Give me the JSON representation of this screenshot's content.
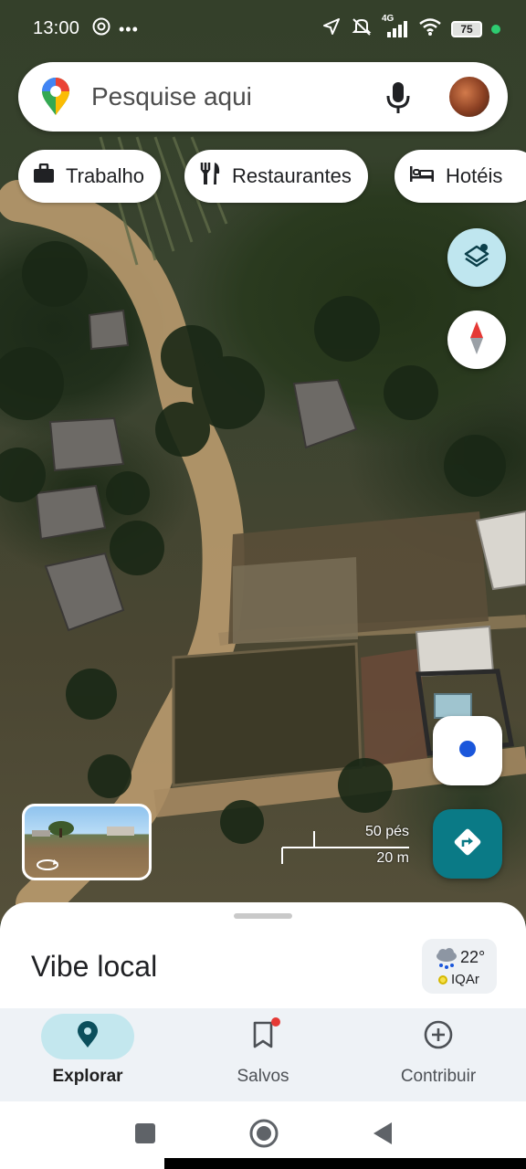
{
  "status_bar": {
    "time": "13:00",
    "battery": "75",
    "network": "4G",
    "icons": [
      "hotspot-icon",
      "more-dots-icon",
      "location-arrow-icon",
      "mute-icon",
      "signal-icon",
      "wifi-icon"
    ]
  },
  "search": {
    "placeholder": "Pesquise aqui",
    "icons": [
      "maps-pin-logo",
      "mic-icon",
      "avatar"
    ]
  },
  "chips": [
    {
      "label": "Trabalho",
      "icon": "briefcase-icon"
    },
    {
      "label": "Restaurantes",
      "icon": "fork-knife-icon"
    },
    {
      "label": "Hotéis",
      "icon": "bed-icon"
    }
  ],
  "map_controls": {
    "layers_icon": "layers-icon",
    "compass_icon": "compass-icon",
    "location_icon": "my-location-icon",
    "directions_icon": "directions-icon"
  },
  "scale": {
    "imperial": "50 pés",
    "metric": "20 m"
  },
  "sheet": {
    "title": "Vibe local",
    "weather": {
      "temperature": "22°",
      "aqi_label": "IQAr",
      "icon": "rain-cloud-icon"
    }
  },
  "nav": {
    "items": [
      {
        "label": "Explorar",
        "icon": "explore-pin-icon",
        "active": true
      },
      {
        "label": "Salvos",
        "icon": "bookmark-icon",
        "active": false
      },
      {
        "label": "Contribuir",
        "icon": "add-circle-icon",
        "active": false
      }
    ]
  },
  "system_nav": [
    "recents-button",
    "home-button",
    "back-button"
  ],
  "colors": {
    "accent_teal": "#0a7a86",
    "active_pill": "#c3e7ee",
    "location_blue": "#1a56db"
  }
}
